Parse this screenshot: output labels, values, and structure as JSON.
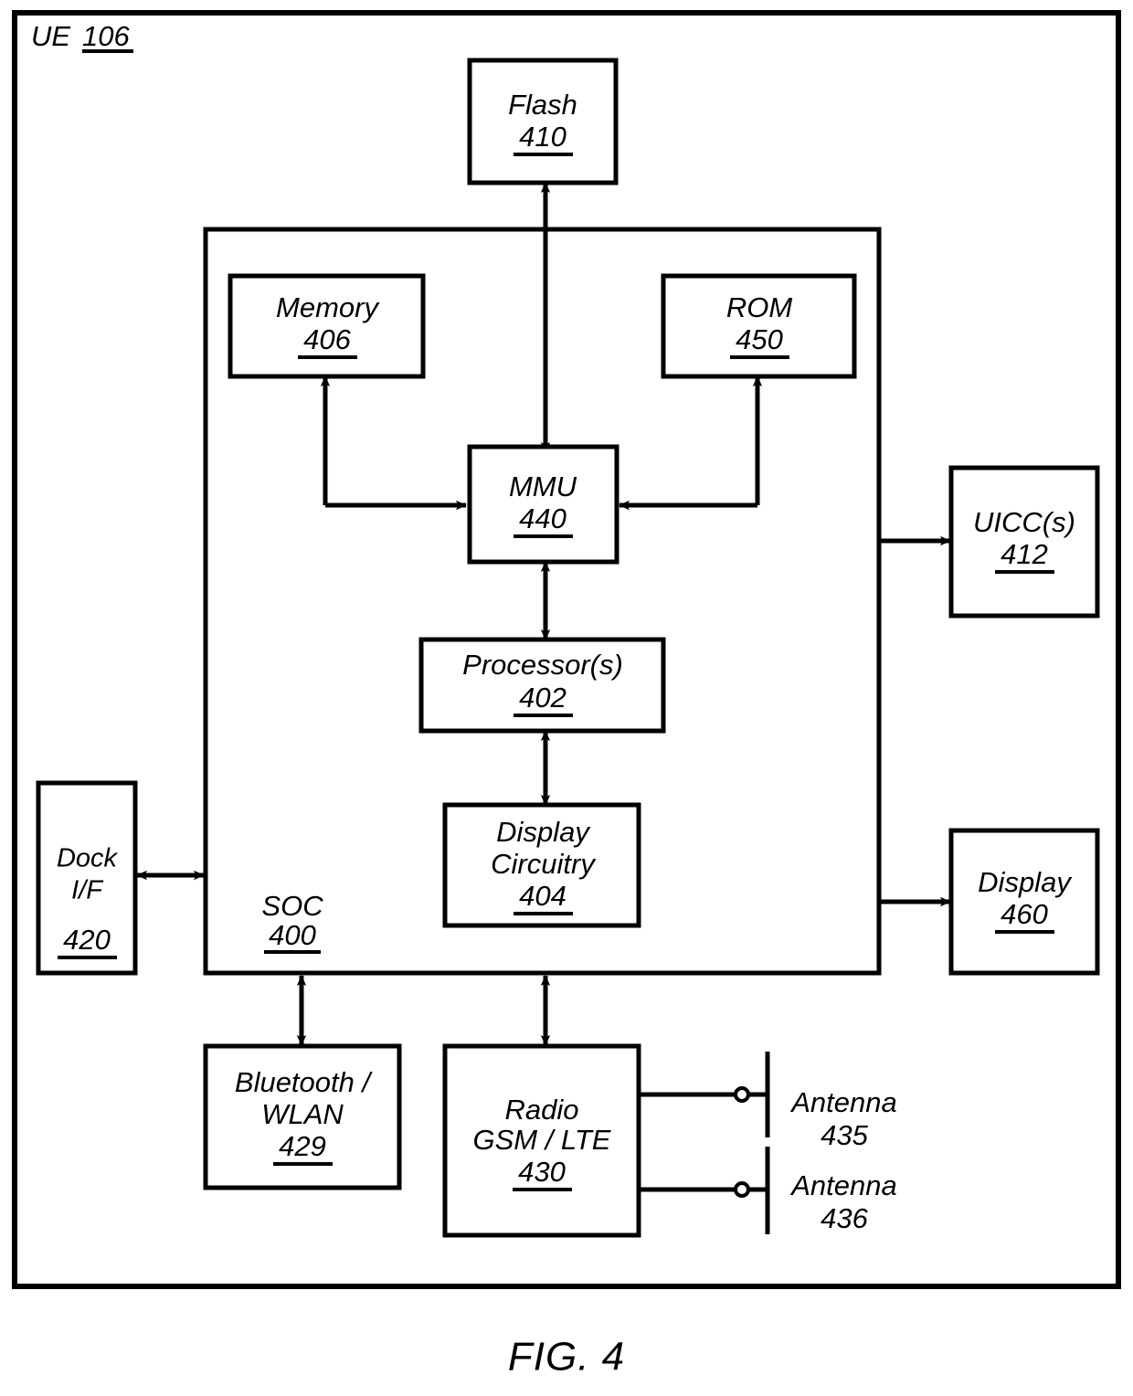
{
  "figure": {
    "caption": "FIG. 4",
    "container_label": "UE",
    "container_ref": "106"
  },
  "blocks": {
    "flash": {
      "label": "Flash",
      "ref": "410"
    },
    "memory": {
      "label": "Memory",
      "ref": "406"
    },
    "rom": {
      "label": "ROM",
      "ref": "450"
    },
    "mmu": {
      "label": "MMU",
      "ref": "440"
    },
    "processor": {
      "label": "Processor(s)",
      "ref": "402"
    },
    "display_circuitry": {
      "label_line1": "Display",
      "label_line2": "Circuitry",
      "ref": "404"
    },
    "soc": {
      "label": "SOC",
      "ref": "400"
    },
    "dock": {
      "label_line1": "Dock",
      "label_line2": "I/F",
      "ref": "420"
    },
    "uicc": {
      "label": "UICC(s)",
      "ref": "412"
    },
    "display": {
      "label": "Display",
      "ref": "460"
    },
    "bluetooth_wlan": {
      "label_line1": "Bluetooth /",
      "label_line2": "WLAN",
      "ref": "429"
    },
    "radio": {
      "label_line1": "Radio",
      "label_line2": "GSM / LTE",
      "ref": "430"
    },
    "antenna_435": {
      "label": "Antenna",
      "ref": "435"
    },
    "antenna_436": {
      "label": "Antenna",
      "ref": "436"
    }
  },
  "colors": {
    "line": "#000000",
    "fill": "#ffffff",
    "text": "#000000"
  }
}
